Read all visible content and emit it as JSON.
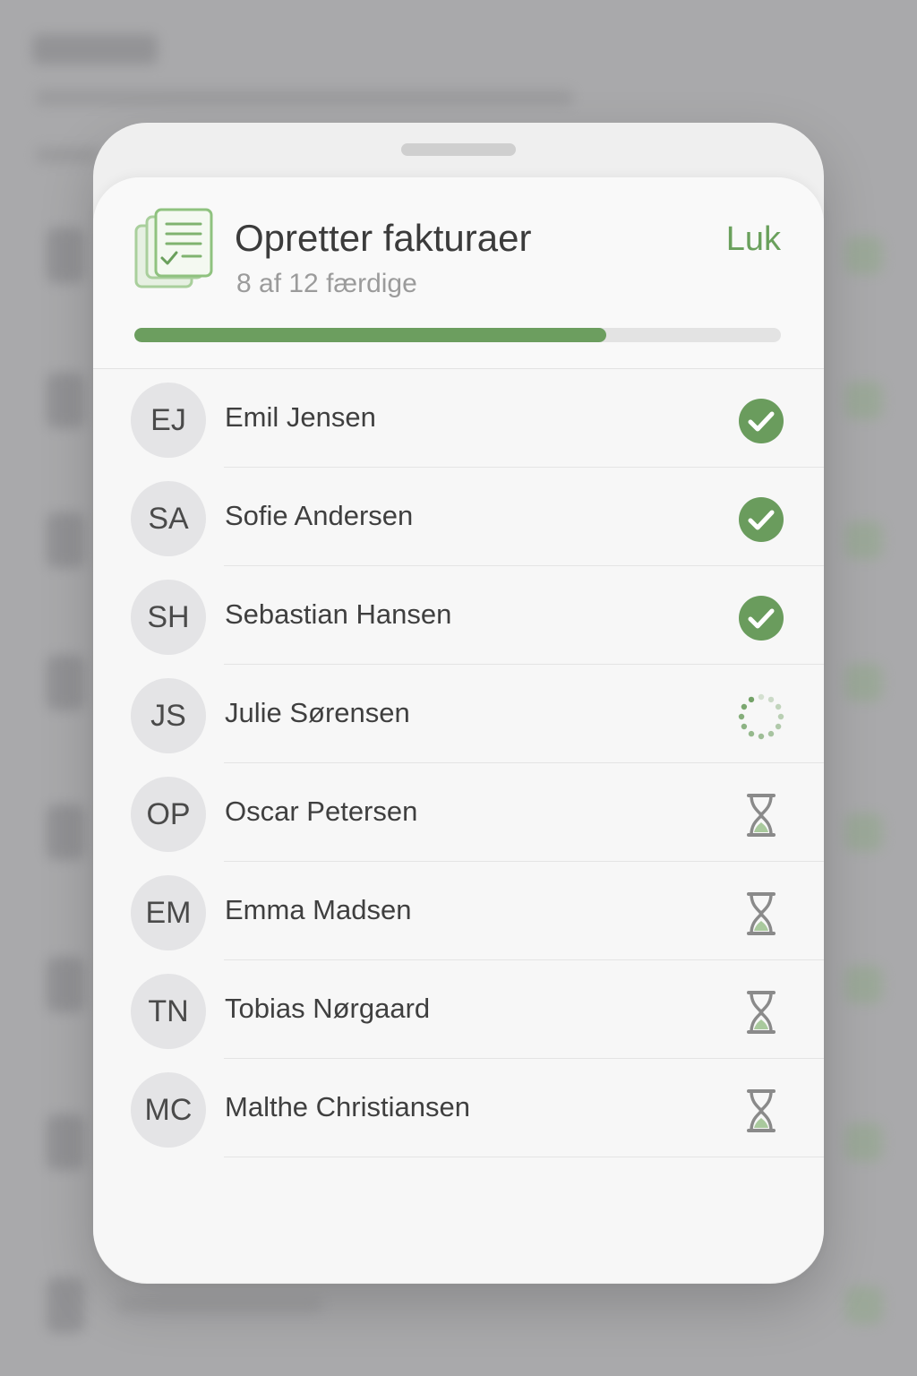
{
  "sheet": {
    "title": "Opretter fakturaer",
    "subtitle": "8 af 12 færdige",
    "close_label": "Luk",
    "progress": 0.73,
    "accent_color": "#6c9e5f"
  },
  "recipients": [
    {
      "initials": "EJ",
      "name": "Emil Jensen",
      "status": "done",
      "status_icon": "check-circle-icon"
    },
    {
      "initials": "SA",
      "name": "Sofie Andersen",
      "status": "done",
      "status_icon": "check-circle-icon"
    },
    {
      "initials": "SH",
      "name": "Sebastian Hansen",
      "status": "done",
      "status_icon": "check-circle-icon"
    },
    {
      "initials": "JS",
      "name": "Julie Sørensen",
      "status": "in-progress",
      "status_icon": "spinner-icon"
    },
    {
      "initials": "OP",
      "name": "Oscar Petersen",
      "status": "pending",
      "status_icon": "hourglass-icon"
    },
    {
      "initials": "EM",
      "name": "Emma Madsen",
      "status": "pending",
      "status_icon": "hourglass-icon"
    },
    {
      "initials": "TN",
      "name": "Tobias Nørgaard",
      "status": "pending",
      "status_icon": "hourglass-icon"
    },
    {
      "initials": "MC",
      "name": "Malthe Christiansen",
      "status": "pending",
      "status_icon": "hourglass-icon"
    }
  ]
}
